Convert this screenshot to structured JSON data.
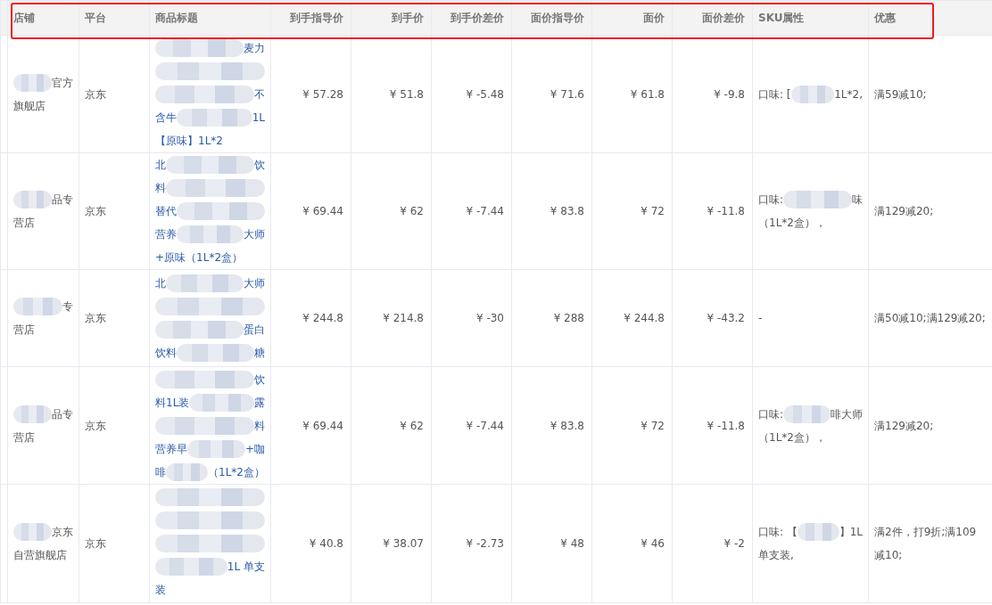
{
  "table": {
    "columns": [
      {
        "label": "店铺"
      },
      {
        "label": "平台"
      },
      {
        "label": "商品标题"
      },
      {
        "label": "到手指导价"
      },
      {
        "label": "到手价"
      },
      {
        "label": "到手价差价"
      },
      {
        "label": "面价指导价"
      },
      {
        "label": "面价"
      },
      {
        "label": "面价差价"
      },
      {
        "label": "SKU属性"
      },
      {
        "label": "优惠"
      }
    ],
    "header_highlighted": true,
    "rows": [
      {
        "shop": [
          {
            "redacted": true,
            "right": "官方"
          },
          {
            "left": "旗舰店"
          }
        ],
        "platform": "京东",
        "title": [
          {
            "redacted": true,
            "right": "麦力"
          },
          {
            "redacted": true
          },
          {
            "redacted": true,
            "right": "不"
          },
          {
            "left": "含牛",
            "redacted": true,
            "right": "1L"
          },
          {
            "left": "【原味】1L*2"
          }
        ],
        "prices": [
          "¥ 57.28",
          "¥ 51.8",
          "¥ -5.48",
          "¥ 71.6",
          "¥ 61.8",
          "¥ -9.8"
        ],
        "sku": [
          {
            "left": "口味: [",
            "redacted": true,
            "right": "1L*2,"
          }
        ],
        "promo": "满59减10;"
      },
      {
        "shop": [
          {
            "redacted": true,
            "right": "品专"
          },
          {
            "left": "营店"
          }
        ],
        "platform": "京东",
        "title": [
          {
            "left": "北",
            "redacted": true,
            "right": "饮"
          },
          {
            "left": "料",
            "redacted": true
          },
          {
            "left": "替代",
            "redacted": true
          },
          {
            "left": "营养",
            "redacted": true,
            "right": "大师"
          },
          {
            "left": "+原味（1L*2盒）"
          }
        ],
        "prices": [
          "¥ 69.44",
          "¥ 62",
          "¥ -7.44",
          "¥ 83.8",
          "¥ 72",
          "¥ -11.8"
        ],
        "sku": [
          {
            "left": "口味:",
            "redacted": true,
            "right": "味"
          },
          {
            "left": "（1L*2盒），"
          }
        ],
        "promo": "满129减20;"
      },
      {
        "shop": [
          {
            "redacted": true,
            "right": "专"
          },
          {
            "left": "营店"
          }
        ],
        "platform": "京东",
        "title": [
          {
            "left": "北",
            "redacted": true,
            "right": "大师"
          },
          {
            "redacted": true
          },
          {
            "redacted": true,
            "right": "蛋白"
          },
          {
            "left": "饮料",
            "redacted": true,
            "right": "糖"
          }
        ],
        "prices": [
          "¥ 244.8",
          "¥ 214.8",
          "¥ -30",
          "¥ 288",
          "¥ 244.8",
          "¥ -43.2"
        ],
        "sku": [
          {
            "left": "-"
          }
        ],
        "promo": "满50减10;满129减20;"
      },
      {
        "shop": [
          {
            "redacted": true,
            "right": "品专"
          },
          {
            "left": "营店"
          }
        ],
        "platform": "京东",
        "title": [
          {
            "redacted": true,
            "right": "饮"
          },
          {
            "left": "料1L装",
            "redacted": true,
            "right": "露"
          },
          {
            "redacted": true,
            "right": "料"
          },
          {
            "left": "营养早",
            "redacted": true,
            "right": "+咖"
          },
          {
            "left": "啡",
            "redacted": true,
            "right": "（1L*2盒）"
          }
        ],
        "prices": [
          "¥ 69.44",
          "¥ 62",
          "¥ -7.44",
          "¥ 83.8",
          "¥ 72",
          "¥ -11.8"
        ],
        "sku": [
          {
            "left": "口味:",
            "redacted": true,
            "right": "啡大师"
          },
          {
            "left": "（1L*2盒），"
          }
        ],
        "promo": "满129减20;"
      },
      {
        "shop": [
          {
            "redacted": true,
            "right": "京东"
          },
          {
            "left": "自营旗舰店"
          }
        ],
        "platform": "京东",
        "title": [
          {
            "redacted": true
          },
          {
            "redacted": true
          },
          {
            "redacted": true
          },
          {
            "redacted": true,
            "right": "1L 单支"
          },
          {
            "left": "装"
          }
        ],
        "prices": [
          "¥ 40.8",
          "¥ 38.07",
          "¥ -2.73",
          "¥ 48",
          "¥ 46",
          "¥ -2"
        ],
        "sku": [
          {
            "left": "口味: 【",
            "redacted": true,
            "right": "】1L"
          },
          {
            "left": "单支装,"
          }
        ],
        "promo": "满2件，打9折;满109减10;"
      }
    ]
  }
}
